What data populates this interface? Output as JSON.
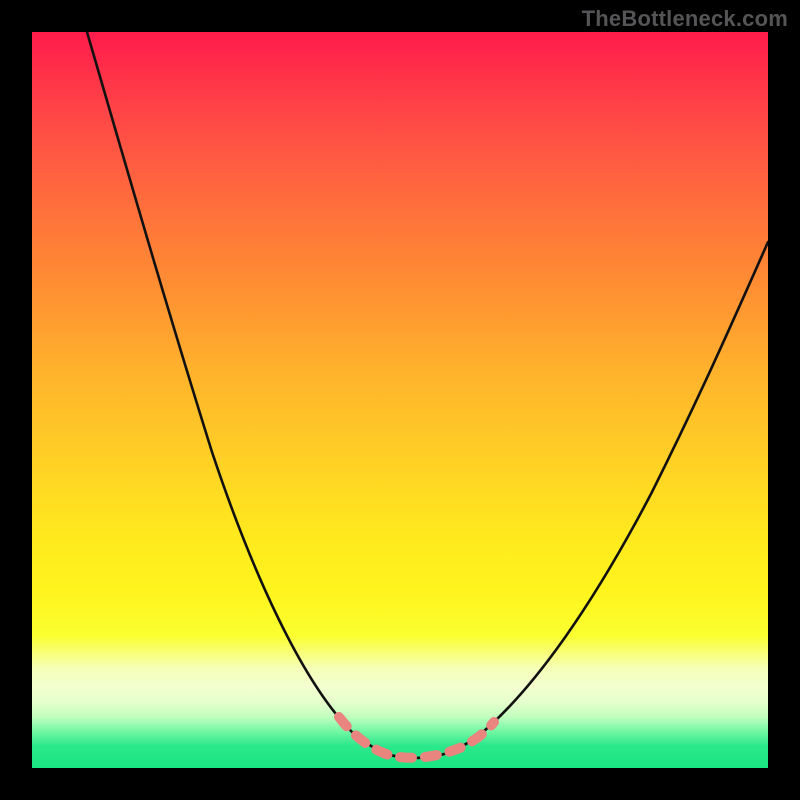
{
  "watermark": {
    "text": "TheBottleneck.com"
  },
  "chart_data": {
    "type": "line",
    "title": "",
    "xlabel": "",
    "ylabel": "",
    "xlim": [
      0,
      100
    ],
    "ylim": [
      0,
      100
    ],
    "grid": false,
    "legend": false,
    "background_gradient": {
      "direction": "vertical",
      "stops": [
        {
          "pos": 0,
          "color": "#ff1b4a",
          "meaning": "severe bottleneck"
        },
        {
          "pos": 50,
          "color": "#ffd025",
          "meaning": "moderate"
        },
        {
          "pos": 100,
          "color": "#19e683",
          "meaning": "no bottleneck"
        }
      ]
    },
    "series": [
      {
        "name": "bottleneck-curve",
        "x": [
          0,
          5,
          10,
          15,
          20,
          25,
          30,
          35,
          40,
          44,
          48,
          50,
          52,
          55,
          58,
          62,
          68,
          75,
          82,
          90,
          100
        ],
        "y": [
          100,
          90,
          79,
          68,
          57,
          46,
          36,
          27,
          18,
          11,
          4,
          1,
          0,
          1,
          3,
          8,
          16,
          27,
          38,
          50,
          65
        ]
      }
    ],
    "optimum_marker": {
      "x_range": [
        42,
        62
      ],
      "y": 1,
      "color": "#e9847e",
      "style": "dashed"
    }
  }
}
